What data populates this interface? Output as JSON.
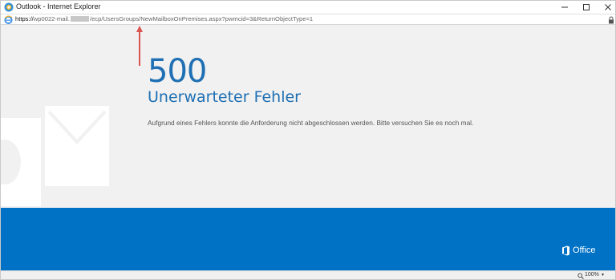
{
  "window": {
    "title": "Outlook - Internet Explorer"
  },
  "address": {
    "scheme": "https://",
    "url_part1": "wp0022-mail.",
    "url_part2": "/ecp/UsersGroups/NewMailboxOnPremises.aspx?pwmcid=3&ReturnObjectType=1"
  },
  "error": {
    "code": "500",
    "title": "Unerwarteter Fehler",
    "message": "Aufgrund eines Fehlers konnte die Anforderung nicht abgeschlossen werden. Bitte versuchen Sie es noch mal."
  },
  "footer": {
    "brand": "Office"
  },
  "status": {
    "zoom": "100%"
  },
  "colors": {
    "accent": "#1e6fb3",
    "footer": "#0072c6",
    "arrow": "#d9534f"
  },
  "icons": [
    "outlook-app-icon",
    "minimize-icon",
    "maximize-icon",
    "close-icon",
    "internet-explorer-icon",
    "lock-icon",
    "outlook-watermark-icon",
    "office-logo-icon",
    "zoom-icon",
    "chevron-down-icon"
  ]
}
